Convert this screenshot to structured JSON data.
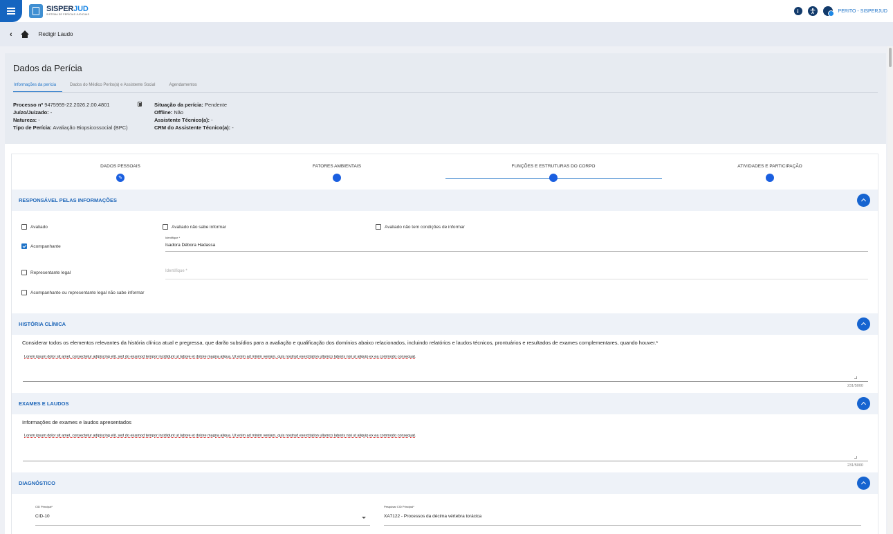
{
  "topbar": {
    "logo_main_a": "SISPER",
    "logo_main_b": "JUD",
    "logo_sub": "SISTEMA DE PERÍCIAS JUDICIAIS",
    "info_icon": "i",
    "user_label": "PERITO - SISPERJUD"
  },
  "breadcrumb": {
    "back": "‹",
    "title": "Redigir Laudo"
  },
  "pericia": {
    "title": "Dados da Perícia",
    "tabs": [
      "Informações da perícia",
      "Dados do Médico Perito(a) e Assistente Social",
      "Agendamentos"
    ],
    "processo_label": "Processo nº",
    "processo_value": "9475959-22.2026.2.00.4801",
    "juizo_label": "Juízo/Juizado:",
    "juizo_value": "-",
    "natureza_label": "Natureza:",
    "natureza_value": "-",
    "tipo_label": "Tipo de Perícia:",
    "tipo_value": "Avaliação Biopsicossocial (BPC)",
    "situacao_label": "Situação da perícia:",
    "situacao_value": "Pendente",
    "offline_label": "Offline:",
    "offline_value": "Não",
    "assistente_label": "Assistente Técnico(a):",
    "assistente_value": "-",
    "crm_label": "CRM do Assistente Técnico(a):",
    "crm_value": "-"
  },
  "stepper": {
    "steps": [
      "DADOS PESSOAIS",
      "FATORES AMBIENTAIS",
      "FUNÇÕES E ESTRUTURAS DO CORPO",
      "ATIVIDADES E PARTICIPAÇÃO"
    ],
    "edit_icon": "✎"
  },
  "responsavel": {
    "title": "RESPONSÁVEL PELAS INFORMAÇÕES",
    "avaliado": "Avaliado",
    "avaliado_nao_sabe": "Avaliado não sabe informar",
    "avaliado_sem_condicoes": "Avaliado não tem condições de informar",
    "acompanhante": "Acompanhante",
    "identifique_label": "Identifique *",
    "identifique_value": "Isadora Débora Hadassa",
    "representante": "Representante legal",
    "identifique_placeholder": "Identifique *",
    "acomp_nao_sabe": "Acompanhante ou representante legal não sabe informar"
  },
  "historia": {
    "title": "HISTÓRIA CLÍNICA",
    "prompt": "Considerar todos os elementos relevantes da história clínica atual e pregressa, que darão subsídios para a avaliação e qualificação dos domínios abaixo relacionados, incluindo relatórios e laudos técnicos, prontuários e resultados de exames complementares, quando houver.*",
    "text": "Lorem ipsum dolor sit amet, consectetur adipiscing elit, sed do eiusmod tempor incididunt ut labore et dolore magna aliqua. Ut enim ad minim veniam, quis nostrud exercitation ullamco laboris nisi ut aliquip ex ea commodo consequat.",
    "counter": "231/5000"
  },
  "exames": {
    "title": "EXAMES E LAUDOS",
    "prompt": "Informações de exames e laudos apresentados",
    "text": "Lorem ipsum dolor sit amet, consectetur adipiscing elit, sed do eiusmod tempor incididunt ut labore et dolore magna aliqua. Ut enim ad minim veniam, quis nostrud exercitation ullamco laboris nisi ut aliquip ex ea commodo consequat.",
    "counter": "231/5000"
  },
  "diagnostico": {
    "title": "DIAGNÓSTICO",
    "cid_label": "CID Principal*",
    "cid_value": "CID-10",
    "pesquisar_label": "Pesquisar CID Principal*",
    "pesquisar_value": "XA7122 - Processos da décima vértebra torácica"
  },
  "colors": {
    "primary": "#1664d0",
    "accent": "#1e73c8",
    "header_bg": "#e7ebf1"
  }
}
